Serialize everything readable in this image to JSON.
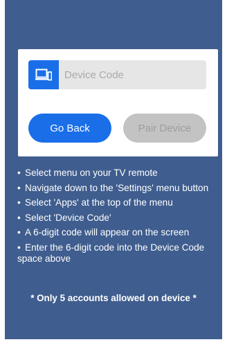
{
  "device_code": {
    "icon": "tv-device-icon",
    "placeholder": "Device Code",
    "value": ""
  },
  "buttons": {
    "go_back": "Go Back",
    "pair_device": "Pair Device",
    "pair_device_enabled": false
  },
  "instructions": [
    "Select menu on your TV remote",
    "Navigate down to the 'Settings' menu button",
    "Select 'Apps' at the top of the menu",
    "Select 'Device Code'",
    "A 6-digit code will appear on the screen",
    "Enter the 6-digit code into the Device Code space above"
  ],
  "note": "* Only 5 accounts allowed on device *",
  "colors": {
    "background": "#3f5d8e",
    "accent": "#1a6ee8",
    "disabled": "#c3c3c3"
  }
}
